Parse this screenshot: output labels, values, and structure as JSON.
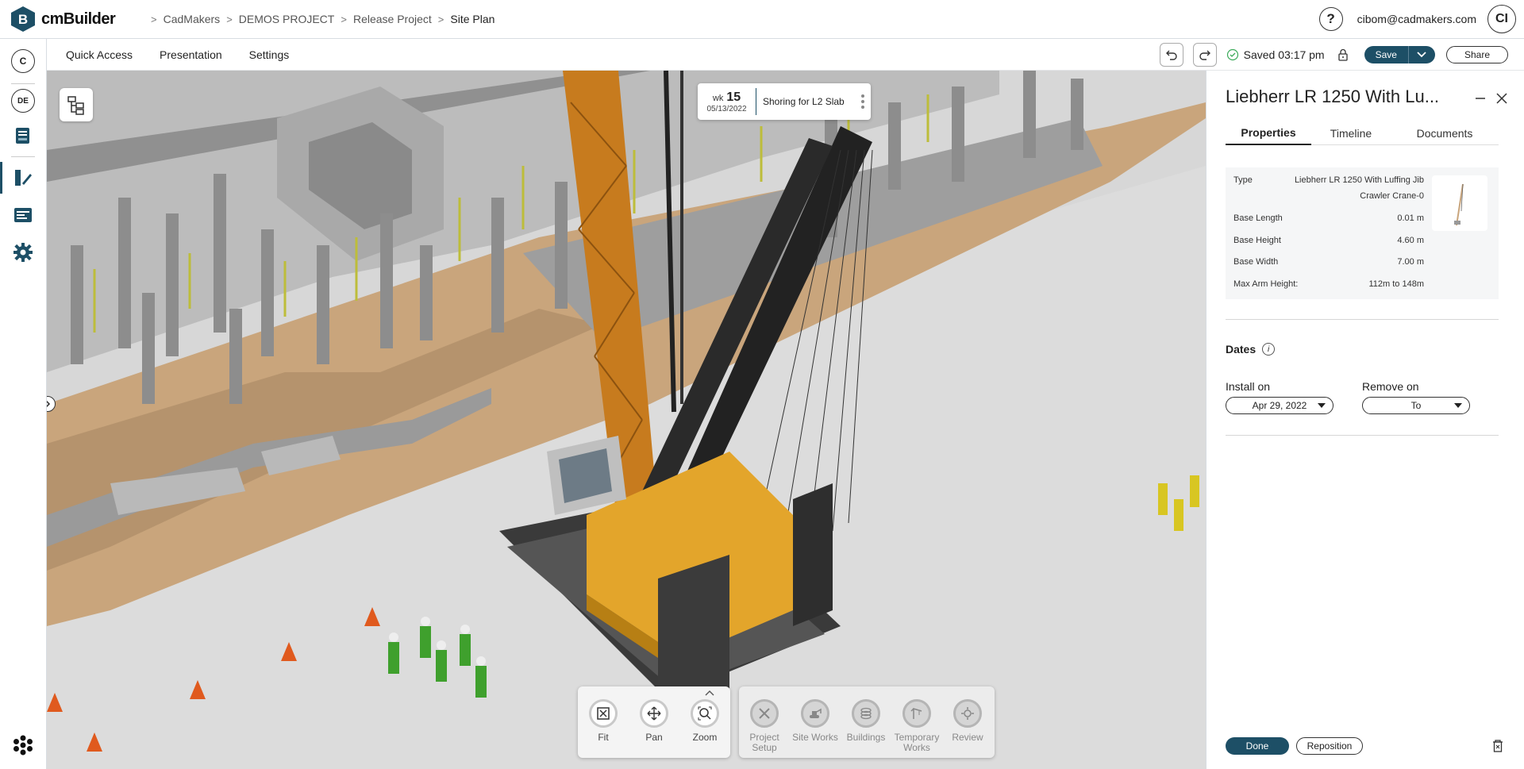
{
  "app": {
    "brand_letter": "B",
    "name": "cmBuilder"
  },
  "breadcrumb": [
    "CadMakers",
    "DEMOS PROJECT",
    "Release Project",
    "Site Plan"
  ],
  "user": {
    "help": "?",
    "email": "cibom@cadmakers.com",
    "initials": "CI"
  },
  "rail": {
    "c_label": "C",
    "de_label": "DE"
  },
  "menu": [
    "Quick Access",
    "Presentation",
    "Settings"
  ],
  "save_bar": {
    "status": "Saved 03:17 pm",
    "save_label": "Save",
    "share_label": "Share"
  },
  "week_chip": {
    "wk_label": "wk",
    "wk_number": "15",
    "date": "05/13/2022",
    "task": "Shoring for L2 Slab"
  },
  "nav_tools": [
    {
      "label": "Fit",
      "icon": "fit-icon"
    },
    {
      "label": "Pan",
      "icon": "pan-icon"
    },
    {
      "label": "Zoom",
      "icon": "zoom-icon"
    }
  ],
  "phase_tools": [
    {
      "label": "Project Setup",
      "icon": "tools-icon"
    },
    {
      "label": "Site Works",
      "icon": "excavator-icon"
    },
    {
      "label": "Buildings",
      "icon": "buildings-icon"
    },
    {
      "label": "Temporary Works",
      "icon": "crane-icon"
    },
    {
      "label": "Review",
      "icon": "review-icon"
    }
  ],
  "panel": {
    "title": "Liebherr LR 1250 With Lu...",
    "tabs": [
      "Properties",
      "Timeline",
      "Documents"
    ],
    "properties": [
      {
        "key": "Type",
        "value": "Liebherr LR 1250 With Luffing Jib Crawler Crane-0"
      },
      {
        "key": "Base Length",
        "value": "0.01 m"
      },
      {
        "key": "Base Height",
        "value": "4.60 m"
      },
      {
        "key": "Base Width",
        "value": "7.00 m"
      },
      {
        "key": "Max Arm Height:",
        "value": "112m to 148m"
      }
    ],
    "dates_title": "Dates",
    "install_label": "Install on",
    "install_value": "Apr 29, 2022",
    "remove_label": "Remove on",
    "remove_value": "To",
    "done_label": "Done",
    "reposition_label": "Reposition"
  },
  "colors": {
    "accent": "#1d4f66",
    "crane_yellow": "#e3a52b",
    "ground_tan": "#c9a57c",
    "worker_green": "#3fa02d"
  }
}
